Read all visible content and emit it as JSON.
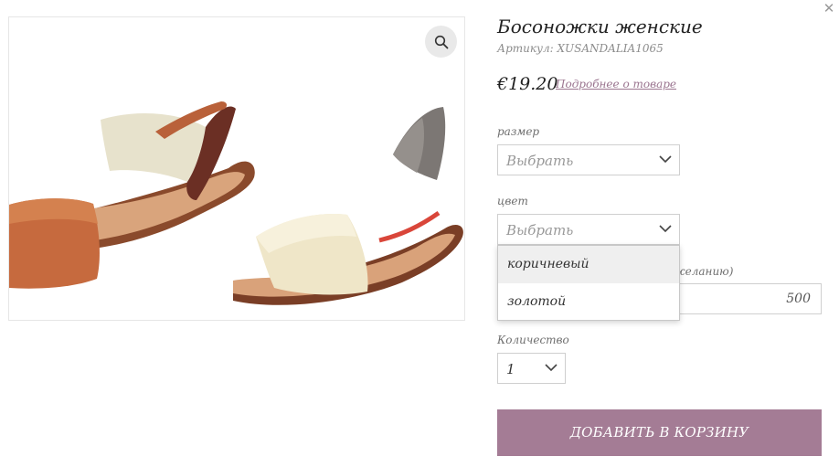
{
  "close_icon": "close-icon",
  "zoom_icon": "magnifier-icon",
  "product": {
    "title": "Босоножки женские",
    "sku": "Артикул: XUSANDALIA1065",
    "price": "€19.20",
    "details_link": "Подробнее о товаре"
  },
  "size": {
    "label": "размер",
    "value": "Выбрать"
  },
  "color": {
    "label": "цвет",
    "value": "Выбрать",
    "options": [
      "коричневый",
      "золотой"
    ]
  },
  "amount": {
    "label_partial": "желанию)",
    "value": "500"
  },
  "quantity": {
    "label": "Количество",
    "value": "1"
  },
  "add_to_cart": "ДОБАВИТЬ В КОРЗИНУ",
  "colors": {
    "accent": "#a47c95",
    "link": "#9b7590"
  }
}
